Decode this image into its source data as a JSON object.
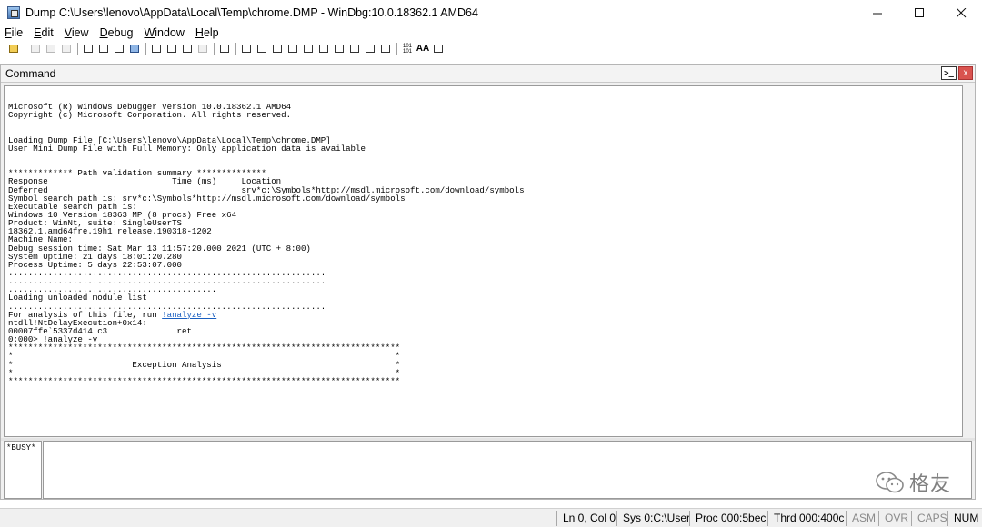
{
  "window": {
    "title": "Dump C:\\Users\\lenovo\\AppData\\Local\\Temp\\chrome.DMP - WinDbg:10.0.18362.1 AMD64",
    "minimize_label": "—",
    "maximize_label": "☐",
    "close_label": "✕"
  },
  "menu": [
    {
      "label": "File",
      "hotkey": "F",
      "rest": "ile"
    },
    {
      "label": "Edit",
      "hotkey": "E",
      "rest": "dit"
    },
    {
      "label": "View",
      "hotkey": "V",
      "rest": "iew"
    },
    {
      "label": "Debug",
      "hotkey": "D",
      "rest": "ebug"
    },
    {
      "label": "Window",
      "hotkey": "W",
      "rest": "indow"
    },
    {
      "label": "Help",
      "hotkey": "H",
      "rest": "elp"
    }
  ],
  "toolbar": {
    "source_mode_label": "101\n101",
    "font_label": "AA"
  },
  "command_window": {
    "title": "Command",
    "dock_icon_label": ">_",
    "close_label": "x",
    "output_lines": [
      "",
      "Microsoft (R) Windows Debugger Version 10.0.18362.1 AMD64",
      "Copyright (c) Microsoft Corporation. All rights reserved.",
      "",
      "",
      "Loading Dump File [C:\\Users\\lenovo\\AppData\\Local\\Temp\\chrome.DMP]",
      "User Mini Dump File with Full Memory: Only application data is available",
      "",
      "",
      "************* Path validation summary **************",
      "Response                         Time (ms)     Location",
      "Deferred                                       srv*c:\\Symbols*http://msdl.microsoft.com/download/symbols",
      "Symbol search path is: srv*c:\\Symbols*http://msdl.microsoft.com/download/symbols",
      "Executable search path is:",
      "Windows 10 Version 18363 MP (8 procs) Free x64",
      "Product: WinNt, suite: SingleUserTS",
      "18362.1.amd64fre.19h1_release.190318-1202",
      "Machine Name:",
      "Debug session time: Sat Mar 13 11:57:20.000 2021 (UTC + 8:00)",
      "System Uptime: 21 days 18:01:20.280",
      "Process Uptime: 5 days 22:53:07.000",
      "................................................................",
      "................................................................",
      "..........................................",
      "Loading unloaded module list",
      "................................................................",
      "For analysis of this file, run ",
      "ntdll!NtDelayExecution+0x14:",
      "00007ffe`5337d414 c3              ret",
      "0:000> !analyze -v",
      "*******************************************************************************",
      "*                                                                             *",
      "*                        Exception Analysis                                   *",
      "*                                                                             *",
      "*******************************************************************************"
    ],
    "analyze_link": "!analyze -v",
    "prompt": "*BUSY*",
    "input_value": ""
  },
  "watermark": {
    "text": "格友"
  },
  "status": {
    "position": "Ln 0, Col 0",
    "sys": "Sys 0:C:\\User",
    "proc": "Proc 000:5bec",
    "thrd": "Thrd 000:400c",
    "asm": "ASM",
    "ovr": "OVR",
    "caps": "CAPS",
    "num": "NUM"
  }
}
